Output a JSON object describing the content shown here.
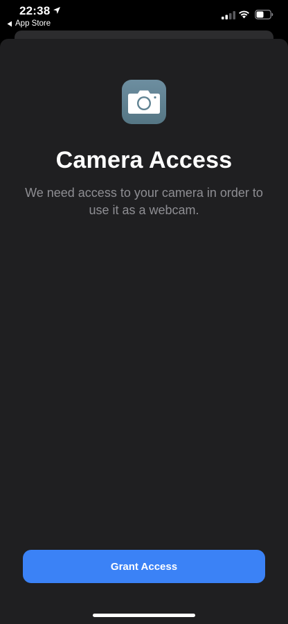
{
  "status_bar": {
    "time": "22:38",
    "back_label": "App Store",
    "icons": [
      "location-arrow-icon",
      "back-arrow-icon",
      "cellular-signal-icon",
      "wifi-icon",
      "battery-icon"
    ]
  },
  "permission": {
    "icon": "camera-icon",
    "title": "Camera Access",
    "message": "We need access to your camera in order to use it as a webcam.",
    "button_label": "Grant Access"
  },
  "colors": {
    "background": "#000000",
    "sheet": "#1f1f21",
    "accent": "#3b82f6",
    "icon_background": "#5f8292",
    "secondary_text": "#8e8e93"
  }
}
